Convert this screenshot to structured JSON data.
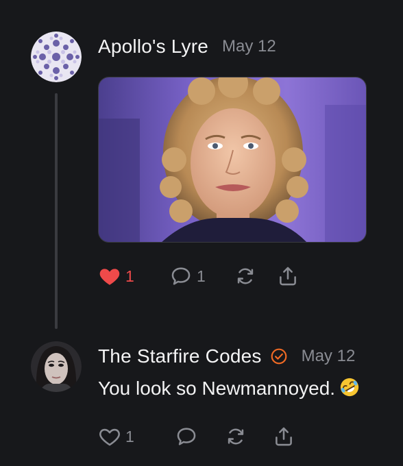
{
  "colors": {
    "background": "#17181b",
    "liked": "#ef4a4a",
    "verified": "#f06a24",
    "muted": "#8a8c93"
  },
  "posts": [
    {
      "author": "Apollo's Lyre",
      "date": "May 12",
      "media": "photo of a woman with curly blonde hair on a purple studio background",
      "liked": true,
      "actions": {
        "like_count": "1",
        "reply_count": "1"
      }
    },
    {
      "author": "The Starfire Codes",
      "verified": true,
      "date": "May 12",
      "text": "You look so Newmannoyed.",
      "emoji": "rolling-on-the-floor-laughing",
      "liked": false,
      "actions": {
        "like_count": "1"
      }
    }
  ]
}
